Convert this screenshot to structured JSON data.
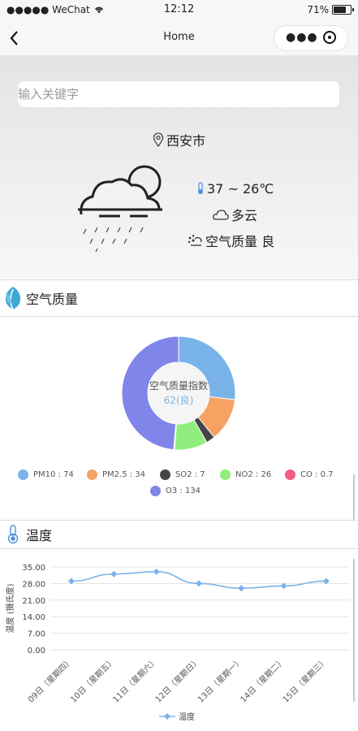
{
  "status_bar": {
    "signal": "●●●●● WeChat",
    "time": "12:12",
    "battery": "71%"
  },
  "nav": {
    "title": "Home",
    "back_icon": "chevron-left-icon",
    "more_icon": "more-icon",
    "target_icon": "target-icon"
  },
  "search": {
    "placeholder": "输入关键字",
    "value": ""
  },
  "location": {
    "city": "西安市"
  },
  "weather": {
    "temp_range": "37 ~ 26℃",
    "condition": "多云",
    "air_quality": "空气质量 良"
  },
  "air_section": {
    "title": "空气质量",
    "center_label": "空气质量指数",
    "center_value": "62(良)"
  },
  "temp_section": {
    "title": "温度"
  },
  "colors": {
    "pm10": "#7ab3e8",
    "pm25": "#f5a263",
    "so2": "#444449",
    "no2": "#90ed7d",
    "co": "#f15c80",
    "o3": "#8085e9"
  },
  "chart_data": [
    {
      "type": "pie",
      "title": "空气质量指数",
      "center_value": "62(良)",
      "series": [
        {
          "name": "PM10",
          "value": 74,
          "label": "PM10 : 74",
          "color": "#7ab3e8"
        },
        {
          "name": "PM2.5",
          "value": 34,
          "label": "PM2.5 : 34",
          "color": "#f5a263"
        },
        {
          "name": "SO2",
          "value": 7,
          "label": "SO2 : 7",
          "color": "#444449"
        },
        {
          "name": "NO2",
          "value": 26,
          "label": "NO2 : 26",
          "color": "#90ed7d"
        },
        {
          "name": "CO",
          "value": 0.7,
          "label": "CO : 0.7",
          "color": "#f15c80"
        },
        {
          "name": "O3",
          "value": 134,
          "label": "O3 : 134",
          "color": "#8085e9"
        }
      ]
    },
    {
      "type": "line",
      "categories": [
        "09日（星期四）",
        "10日（星期五）",
        "11日（星期六）",
        "12日（星期日）",
        "13日（星期一）",
        "14日（星期二）",
        "15日（星期三）"
      ],
      "series": [
        {
          "name": "温度",
          "values": [
            29,
            32,
            33,
            28,
            26,
            27,
            29
          ],
          "color": "#7ab3e8"
        }
      ],
      "ylabel": "温度 (摄氏度)",
      "ylim": [
        0,
        35
      ],
      "yticks": [
        "0.00",
        "7.00",
        "14.00",
        "21.00",
        "28.00",
        "35.00"
      ],
      "legend": "bottom",
      "grid": true
    }
  ]
}
